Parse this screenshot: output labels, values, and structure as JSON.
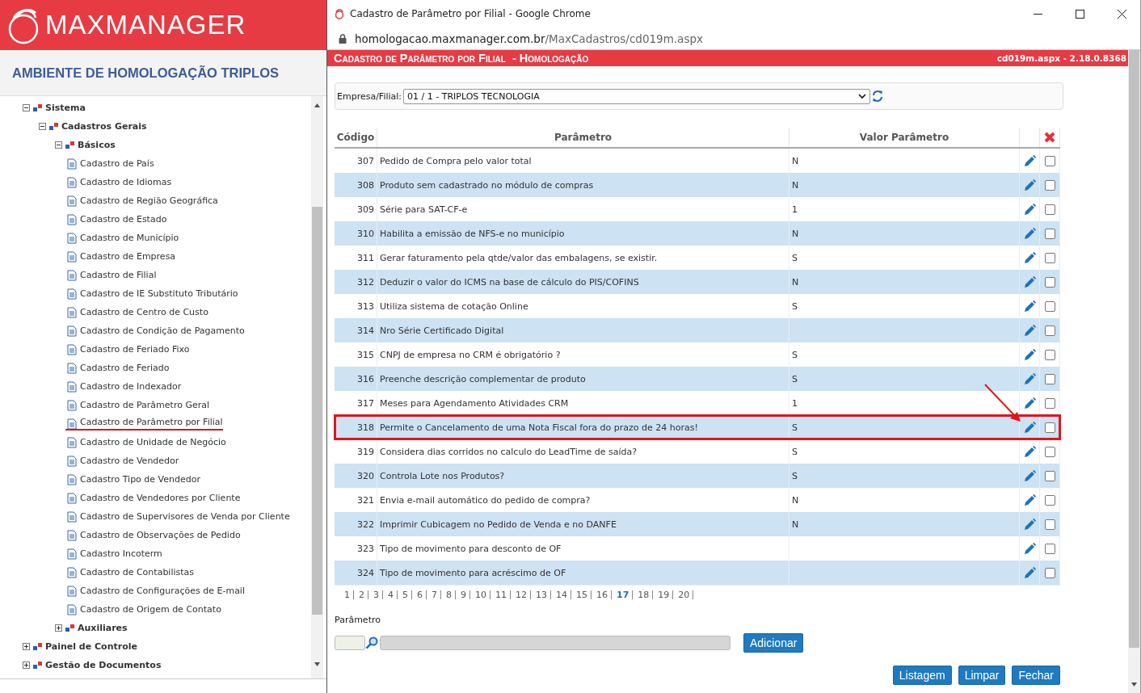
{
  "app": {
    "logo": "MAXMANAGER",
    "environment": "AMBIENTE DE HOMOLOGAÇÃO TRIPLOS"
  },
  "tree": [
    {
      "kind": "folder",
      "label": "Sistema",
      "expanded": true,
      "children": [
        {
          "kind": "folder",
          "label": "Cadastros Gerais",
          "expanded": true,
          "children": [
            {
              "kind": "folder",
              "label": "Básicos",
              "expanded": true,
              "children": [
                {
                  "kind": "page",
                  "label": "Cadastro de País",
                  "underlined": false
                },
                {
                  "kind": "page",
                  "label": "Cadastro de Idiomas",
                  "underlined": false
                },
                {
                  "kind": "page",
                  "label": "Cadastro de Região Geográfica",
                  "underlined": false
                },
                {
                  "kind": "page",
                  "label": "Cadastro de Estado",
                  "underlined": false
                },
                {
                  "kind": "page",
                  "label": "Cadastro de Município",
                  "underlined": false
                },
                {
                  "kind": "page",
                  "label": "Cadastro de Empresa",
                  "underlined": false
                },
                {
                  "kind": "page",
                  "label": "Cadastro de Filial",
                  "underlined": false
                },
                {
                  "kind": "page",
                  "label": "Cadastro de IE Substituto Tributário",
                  "underlined": false
                },
                {
                  "kind": "page",
                  "label": "Cadastro de Centro de Custo",
                  "underlined": false
                },
                {
                  "kind": "page",
                  "label": "Cadastro de Condição de Pagamento",
                  "underlined": false
                },
                {
                  "kind": "page",
                  "label": "Cadastro de Feriado Fixo",
                  "underlined": false
                },
                {
                  "kind": "page",
                  "label": "Cadastro de Feriado",
                  "underlined": false
                },
                {
                  "kind": "page",
                  "label": "Cadastro de Indexador",
                  "underlined": false
                },
                {
                  "kind": "page",
                  "label": "Cadastro de Parâmetro Geral",
                  "underlined": false
                },
                {
                  "kind": "page",
                  "label": "Cadastro de Parâmetro por Filial",
                  "underlined": true
                },
                {
                  "kind": "page",
                  "label": "Cadastro de Unidade de Negócio",
                  "underlined": false
                },
                {
                  "kind": "page",
                  "label": "Cadastro de Vendedor",
                  "underlined": false
                },
                {
                  "kind": "page",
                  "label": "Cadastro Tipo de Vendedor",
                  "underlined": false
                },
                {
                  "kind": "page",
                  "label": "Cadastro de Vendedores por Cliente",
                  "underlined": false
                },
                {
                  "kind": "page",
                  "label": "Cadastro de Supervisores de Venda por Cliente",
                  "underlined": false
                },
                {
                  "kind": "page",
                  "label": "Cadastro de Observações de Pedido",
                  "underlined": false
                },
                {
                  "kind": "page",
                  "label": "Cadastro Incoterm",
                  "underlined": false
                },
                {
                  "kind": "page",
                  "label": "Cadastro de Contabilistas",
                  "underlined": false
                },
                {
                  "kind": "page",
                  "label": "Cadastro de Configurações de E-mail",
                  "underlined": false
                },
                {
                  "kind": "page",
                  "label": "Cadastro de Origem de Contato",
                  "underlined": false
                }
              ]
            },
            {
              "kind": "folder",
              "label": "Auxiliares",
              "expanded": false
            }
          ]
        }
      ]
    },
    {
      "kind": "folder",
      "label": "Painel de Controle",
      "expanded": false
    },
    {
      "kind": "folder",
      "label": "Gestão de Documentos",
      "expanded": false
    }
  ],
  "browser": {
    "title": "Cadastro de Parâmetro por Filial - Google Chrome",
    "url_domain": "homologacao.maxmanager.com.br",
    "url_path": "/MaxCadastros/cd019m.aspx"
  },
  "page_header": {
    "title": "Cadastro de Parâmetro por Filial  - Homologação",
    "version": "cd019m.aspx - 2.18.0.8368"
  },
  "filter": {
    "label": "Empresa/Filial:",
    "value": "01 / 1 - TRIPLOS TECNOLOGIA"
  },
  "table": {
    "columns": [
      "Código",
      "Parâmetro",
      "Valor Parâmetro"
    ],
    "rows": [
      {
        "code": "307",
        "parameter": "Pedido de Compra pelo valor total",
        "value": "N",
        "checked": false,
        "highlighted": false
      },
      {
        "code": "308",
        "parameter": "Produto sem cadastrado no módulo de compras",
        "value": "N",
        "checked": false,
        "highlighted": false
      },
      {
        "code": "309",
        "parameter": "Série para SAT-CF-e",
        "value": "1",
        "checked": false,
        "highlighted": false
      },
      {
        "code": "310",
        "parameter": "Habilita a emissão de NFS-e no município",
        "value": "N",
        "checked": false,
        "highlighted": false
      },
      {
        "code": "311",
        "parameter": "Gerar faturamento pela qtde/valor das embalagens, se existir.",
        "value": "S",
        "checked": false,
        "highlighted": false
      },
      {
        "code": "312",
        "parameter": "Deduzir o valor do ICMS na base de cálculo do PIS/COFINS",
        "value": "N",
        "checked": false,
        "highlighted": false
      },
      {
        "code": "313",
        "parameter": "Utiliza sistema de cotação Online",
        "value": "S",
        "checked": false,
        "highlighted": false
      },
      {
        "code": "314",
        "parameter": "Nro Série Certificado Digital",
        "checked": false,
        "highlighted": false
      },
      {
        "code": "315",
        "parameter": "CNPJ de empresa no CRM é obrigatório ?",
        "value": "S",
        "checked": false,
        "highlighted": false
      },
      {
        "code": "316",
        "parameter": "Preenche descrição complementar de produto",
        "value": "S",
        "checked": false,
        "highlighted": false
      },
      {
        "code": "317",
        "parameter": "Meses para Agendamento Atividades CRM",
        "value": "1",
        "checked": false,
        "highlighted": false
      },
      {
        "code": "318",
        "parameter": "Permite o Cancelamento de uma Nota Fiscal fora do prazo de 24 horas!",
        "value": "S",
        "checked": false,
        "highlighted": true
      },
      {
        "code": "319",
        "parameter": "Considera dias corridos no calculo do LeadTime de saída?",
        "value": "S",
        "checked": false,
        "highlighted": false
      },
      {
        "code": "320",
        "parameter": "Controla Lote nos Produtos?",
        "value": "S",
        "checked": false,
        "highlighted": false
      },
      {
        "code": "321",
        "parameter": "Envia e-mail automático do pedido de compra?",
        "value": "N",
        "checked": false,
        "highlighted": false
      },
      {
        "code": "322",
        "parameter": "Imprimir Cubicagem no Pedido de Venda e no DANFE",
        "value": "N",
        "checked": false,
        "highlighted": false
      },
      {
        "code": "323",
        "parameter": "Tipo de movimento para desconto de OF",
        "checked": false,
        "highlighted": false
      },
      {
        "code": "324",
        "parameter": "Tipo de movimento para acréscimo de OF",
        "checked": false,
        "highlighted": false
      }
    ]
  },
  "pager": [
    {
      "label": "1",
      "selected": false
    },
    {
      "label": "2",
      "selected": false
    },
    {
      "label": "3",
      "selected": false
    },
    {
      "label": "4",
      "selected": false
    },
    {
      "label": "5",
      "selected": false
    },
    {
      "label": "6",
      "selected": false
    },
    {
      "label": "7",
      "selected": false
    },
    {
      "label": "8",
      "selected": false
    },
    {
      "label": "9",
      "selected": false
    },
    {
      "label": "10",
      "selected": false
    },
    {
      "label": "11",
      "selected": false
    },
    {
      "label": "12",
      "selected": false
    },
    {
      "label": "13",
      "selected": false
    },
    {
      "label": "14",
      "selected": false
    },
    {
      "label": "15",
      "selected": false
    },
    {
      "label": "16",
      "selected": false
    },
    {
      "label": "17",
      "selected": true
    },
    {
      "label": "18",
      "selected": false
    },
    {
      "label": "19",
      "selected": false
    },
    {
      "label": "20",
      "selected": false
    }
  ],
  "parameter_form": {
    "label": "Parâmetro",
    "add_button": "Adicionar"
  },
  "buttons": [
    "Listagem",
    "Limpar",
    "Fechar"
  ]
}
